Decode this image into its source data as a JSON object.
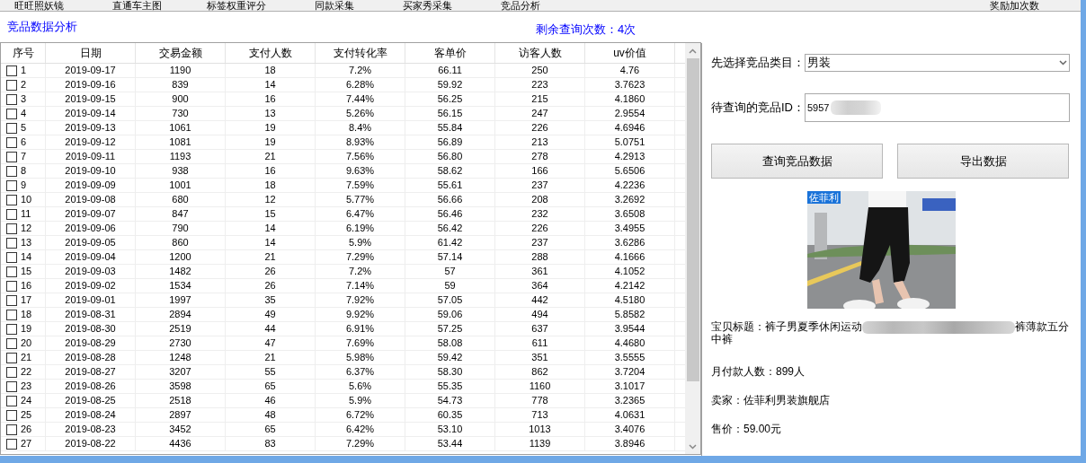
{
  "top_tabs": [
    "旺旺照妖镜",
    "直通车主图",
    "标签权重评分",
    "同款采集",
    "买家秀采集",
    "竞品分析",
    "奖励加次数"
  ],
  "section_title": "竞品数据分析",
  "remaining_queries": "剩余查询次数：4次",
  "table": {
    "columns": [
      "序号",
      "日期",
      "交易金额",
      "支付人数",
      "支付转化率",
      "客单价",
      "访客人数",
      "uv价值"
    ],
    "rows": [
      {
        "checked": false,
        "cells": [
          "1",
          "2019-09-17",
          "1190",
          "18",
          "7.2%",
          "66.11",
          "250",
          "4.76"
        ]
      },
      {
        "checked": false,
        "cells": [
          "2",
          "2019-09-16",
          "839",
          "14",
          "6.28%",
          "59.92",
          "223",
          "3.7623"
        ]
      },
      {
        "checked": false,
        "cells": [
          "3",
          "2019-09-15",
          "900",
          "16",
          "7.44%",
          "56.25",
          "215",
          "4.1860"
        ]
      },
      {
        "checked": false,
        "cells": [
          "4",
          "2019-09-14",
          "730",
          "13",
          "5.26%",
          "56.15",
          "247",
          "2.9554"
        ]
      },
      {
        "checked": false,
        "cells": [
          "5",
          "2019-09-13",
          "1061",
          "19",
          "8.4%",
          "55.84",
          "226",
          "4.6946"
        ]
      },
      {
        "checked": false,
        "cells": [
          "6",
          "2019-09-12",
          "1081",
          "19",
          "8.93%",
          "56.89",
          "213",
          "5.0751"
        ]
      },
      {
        "checked": false,
        "cells": [
          "7",
          "2019-09-11",
          "1193",
          "21",
          "7.56%",
          "56.80",
          "278",
          "4.2913"
        ]
      },
      {
        "checked": false,
        "cells": [
          "8",
          "2019-09-10",
          "938",
          "16",
          "9.63%",
          "58.62",
          "166",
          "5.6506"
        ]
      },
      {
        "checked": false,
        "cells": [
          "9",
          "2019-09-09",
          "1001",
          "18",
          "7.59%",
          "55.61",
          "237",
          "4.2236"
        ]
      },
      {
        "checked": false,
        "cells": [
          "10",
          "2019-09-08",
          "680",
          "12",
          "5.77%",
          "56.66",
          "208",
          "3.2692"
        ]
      },
      {
        "checked": false,
        "cells": [
          "11",
          "2019-09-07",
          "847",
          "15",
          "6.47%",
          "56.46",
          "232",
          "3.6508"
        ]
      },
      {
        "checked": false,
        "cells": [
          "12",
          "2019-09-06",
          "790",
          "14",
          "6.19%",
          "56.42",
          "226",
          "3.4955"
        ]
      },
      {
        "checked": false,
        "cells": [
          "13",
          "2019-09-05",
          "860",
          "14",
          "5.9%",
          "61.42",
          "237",
          "3.6286"
        ]
      },
      {
        "checked": false,
        "cells": [
          "14",
          "2019-09-04",
          "1200",
          "21",
          "7.29%",
          "57.14",
          "288",
          "4.1666"
        ]
      },
      {
        "checked": false,
        "cells": [
          "15",
          "2019-09-03",
          "1482",
          "26",
          "7.2%",
          "57",
          "361",
          "4.1052"
        ]
      },
      {
        "checked": false,
        "cells": [
          "16",
          "2019-09-02",
          "1534",
          "26",
          "7.14%",
          "59",
          "364",
          "4.2142"
        ]
      },
      {
        "checked": false,
        "cells": [
          "17",
          "2019-09-01",
          "1997",
          "35",
          "7.92%",
          "57.05",
          "442",
          "4.5180"
        ]
      },
      {
        "checked": false,
        "cells": [
          "18",
          "2019-08-31",
          "2894",
          "49",
          "9.92%",
          "59.06",
          "494",
          "5.8582"
        ]
      },
      {
        "checked": false,
        "cells": [
          "19",
          "2019-08-30",
          "2519",
          "44",
          "6.91%",
          "57.25",
          "637",
          "3.9544"
        ]
      },
      {
        "checked": false,
        "cells": [
          "20",
          "2019-08-29",
          "2730",
          "47",
          "7.69%",
          "58.08",
          "611",
          "4.4680"
        ]
      },
      {
        "checked": false,
        "cells": [
          "21",
          "2019-08-28",
          "1248",
          "21",
          "5.98%",
          "59.42",
          "351",
          "3.5555"
        ]
      },
      {
        "checked": false,
        "cells": [
          "22",
          "2019-08-27",
          "3207",
          "55",
          "6.37%",
          "58.30",
          "862",
          "3.7204"
        ]
      },
      {
        "checked": false,
        "cells": [
          "23",
          "2019-08-26",
          "3598",
          "65",
          "5.6%",
          "55.35",
          "1160",
          "3.1017"
        ]
      },
      {
        "checked": false,
        "cells": [
          "24",
          "2019-08-25",
          "2518",
          "46",
          "5.9%",
          "54.73",
          "778",
          "3.2365"
        ]
      },
      {
        "checked": false,
        "cells": [
          "25",
          "2019-08-24",
          "2897",
          "48",
          "6.72%",
          "60.35",
          "713",
          "4.0631"
        ]
      },
      {
        "checked": false,
        "cells": [
          "26",
          "2019-08-23",
          "3452",
          "65",
          "6.42%",
          "53.10",
          "1013",
          "3.4076"
        ]
      },
      {
        "checked": false,
        "cells": [
          "27",
          "2019-08-22",
          "4436",
          "83",
          "7.29%",
          "53.44",
          "1139",
          "3.8946"
        ]
      }
    ]
  },
  "category": {
    "label": "先选择竞品类目：",
    "value": "男装"
  },
  "product_id": {
    "label": "待查询的竞品ID：",
    "value": "5957"
  },
  "buttons": [
    "查询竞品数据",
    "导出数据"
  ],
  "product_image": {
    "kind": "picture",
    "badge": "佐菲利"
  },
  "details": [
    {
      "kind": "title",
      "label": "宝贝标题：",
      "before": "裤子男夏季休闲运动",
      "after": "裤薄款五分中裤"
    },
    {
      "kind": "plain",
      "label": "月付款人数：",
      "value": "899人"
    },
    {
      "kind": "plain",
      "label": "卖家：",
      "value": "佐菲利男装旗舰店"
    },
    {
      "kind": "plain",
      "label": "售价：",
      "value": "59.00元"
    }
  ]
}
